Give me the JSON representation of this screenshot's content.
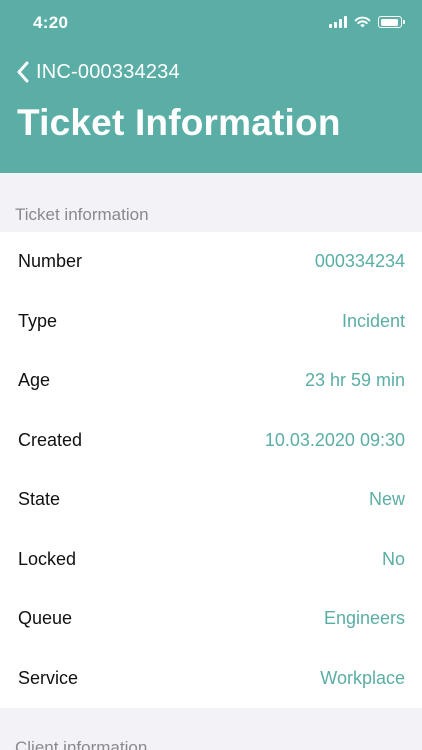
{
  "status_bar": {
    "time": "4:20"
  },
  "header": {
    "back_label": "INC-000334234",
    "title": "Ticket Information"
  },
  "ticket_section": {
    "title": "Ticket information",
    "rows": [
      {
        "label": "Number",
        "value": "000334234"
      },
      {
        "label": "Type",
        "value": "Incident"
      },
      {
        "label": "Age",
        "value": "23 hr 59 min"
      },
      {
        "label": "Created",
        "value": "10.03.2020 09:30"
      },
      {
        "label": "State",
        "value": "New"
      },
      {
        "label": "Locked",
        "value": "No"
      },
      {
        "label": "Queue",
        "value": "Engineers"
      },
      {
        "label": "Service",
        "value": "Workplace"
      }
    ]
  },
  "client_section": {
    "title": "Client information"
  },
  "colors": {
    "accent": "#5aaea5",
    "background": "#f3f3f7",
    "section_text": "#8a8a8e"
  }
}
